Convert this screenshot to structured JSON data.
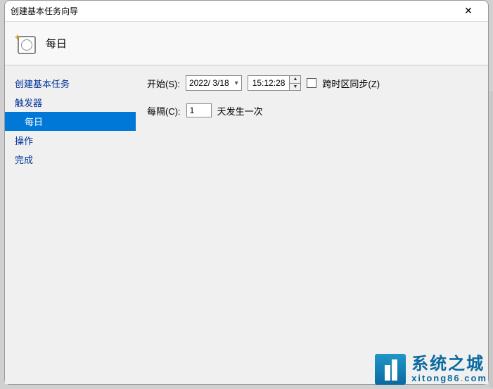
{
  "window": {
    "title": "创建基本任务向导"
  },
  "header": {
    "title": "每日"
  },
  "sidebar": {
    "items": [
      {
        "label": "创建基本任务",
        "sub": false,
        "selected": false
      },
      {
        "label": "触发器",
        "sub": false,
        "selected": false
      },
      {
        "label": "每日",
        "sub": true,
        "selected": true
      },
      {
        "label": "操作",
        "sub": false,
        "selected": false
      },
      {
        "label": "完成",
        "sub": false,
        "selected": false
      }
    ]
  },
  "main": {
    "start_label": "开始(S):",
    "date_value": "2022/ 3/18",
    "time_value": "15:12:28",
    "tz_sync_label": "跨时区同步(Z)",
    "tz_sync_checked": false,
    "every_label": "每隔(C):",
    "every_value": "1",
    "every_suffix": "天发生一次"
  },
  "watermark": {
    "cn": "系统之城",
    "en_pre": "xitong86",
    "en_dot": ".",
    "en_post": "com"
  }
}
